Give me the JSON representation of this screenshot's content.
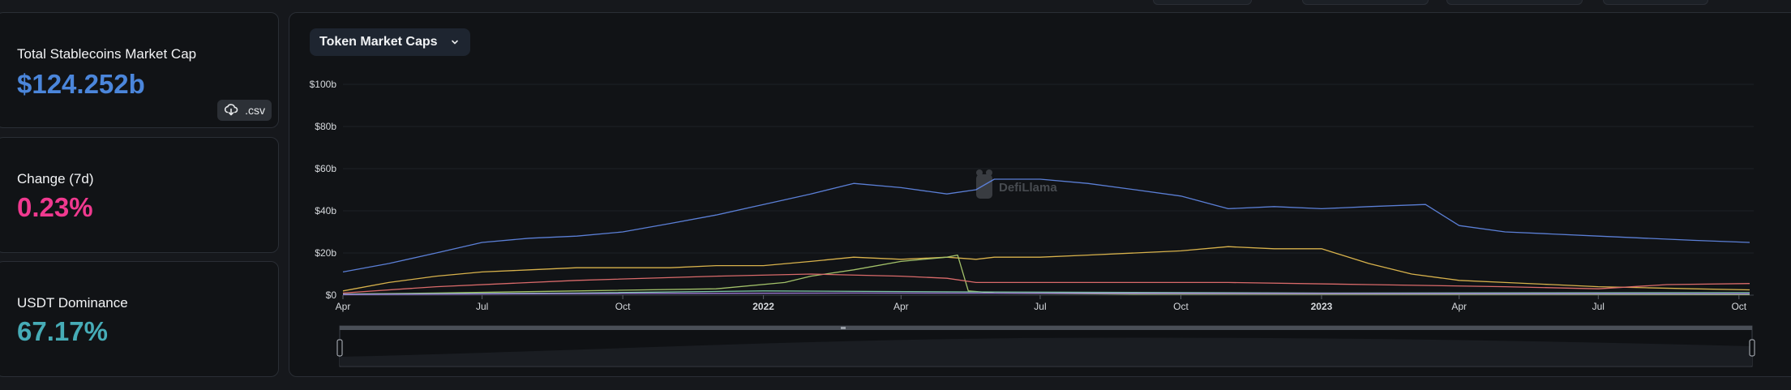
{
  "stats": {
    "market_cap": {
      "label": "Total Stablecoins Market Cap",
      "value": "$124.252b",
      "color": "#4b86db"
    },
    "change": {
      "label": "Change (7d)",
      "value": "0.23%",
      "color": "#f0398f"
    },
    "dominance": {
      "label": "USDT Dominance",
      "value": "67.17%",
      "color": "#46acb7"
    },
    "csv_button": {
      "label": ".csv",
      "icon": "cloud-download-icon"
    }
  },
  "chart_panel": {
    "selector_label": "Token Market Caps",
    "selector_icon": "chevron-down-icon",
    "watermark": "DefiLlama"
  },
  "chart_data": {
    "type": "line",
    "x_tick_labels": [
      "Apr",
      "Jul",
      "Oct",
      "2022",
      "Apr",
      "Jul",
      "Oct",
      "2023",
      "Apr",
      "Jul",
      "Oct"
    ],
    "x_tick_bold": [
      false,
      false,
      false,
      true,
      false,
      false,
      false,
      true,
      false,
      false,
      false
    ],
    "y_tick_labels": [
      "$0",
      "$20b",
      "$40b",
      "$60b",
      "$80b",
      "$100b"
    ],
    "y_ticks": [
      0,
      20,
      40,
      60,
      80,
      100
    ],
    "ylim": [
      0,
      100
    ],
    "x_start": "2021-04-01",
    "x_end": "2023-10-08",
    "grid": true,
    "series": [
      {
        "color": "#5b7fd6",
        "points": [
          [
            "2021-04-01",
            11
          ],
          [
            "2021-05-01",
            15
          ],
          [
            "2021-06-01",
            20
          ],
          [
            "2021-07-01",
            25
          ],
          [
            "2021-08-01",
            27
          ],
          [
            "2021-09-01",
            28
          ],
          [
            "2021-10-01",
            30
          ],
          [
            "2021-11-01",
            34
          ],
          [
            "2021-12-01",
            38
          ],
          [
            "2022-01-01",
            43
          ],
          [
            "2022-02-01",
            48
          ],
          [
            "2022-03-01",
            53
          ],
          [
            "2022-04-01",
            51
          ],
          [
            "2022-05-01",
            48
          ],
          [
            "2022-05-20",
            50
          ],
          [
            "2022-06-01",
            55
          ],
          [
            "2022-07-01",
            55
          ],
          [
            "2022-08-01",
            53
          ],
          [
            "2022-09-01",
            50
          ],
          [
            "2022-10-01",
            47
          ],
          [
            "2022-11-01",
            41
          ],
          [
            "2022-12-01",
            42
          ],
          [
            "2023-01-01",
            41
          ],
          [
            "2023-02-01",
            42
          ],
          [
            "2023-03-10",
            43
          ],
          [
            "2023-04-01",
            33
          ],
          [
            "2023-05-01",
            30
          ],
          [
            "2023-06-01",
            29
          ],
          [
            "2023-07-01",
            28
          ],
          [
            "2023-08-01",
            27
          ],
          [
            "2023-09-01",
            26
          ],
          [
            "2023-10-08",
            25
          ]
        ]
      },
      {
        "color": "#d8b24c",
        "points": [
          [
            "2021-04-01",
            2
          ],
          [
            "2021-05-01",
            6
          ],
          [
            "2021-06-01",
            9
          ],
          [
            "2021-07-01",
            11
          ],
          [
            "2021-08-01",
            12
          ],
          [
            "2021-09-01",
            13
          ],
          [
            "2021-10-01",
            13
          ],
          [
            "2021-11-01",
            13
          ],
          [
            "2021-12-01",
            14
          ],
          [
            "2022-01-01",
            14
          ],
          [
            "2022-02-01",
            16
          ],
          [
            "2022-03-01",
            18
          ],
          [
            "2022-04-01",
            17
          ],
          [
            "2022-05-01",
            18
          ],
          [
            "2022-05-20",
            17
          ],
          [
            "2022-06-01",
            18
          ],
          [
            "2022-07-01",
            18
          ],
          [
            "2022-08-01",
            19
          ],
          [
            "2022-09-01",
            20
          ],
          [
            "2022-10-01",
            21
          ],
          [
            "2022-11-01",
            23
          ],
          [
            "2022-12-01",
            22
          ],
          [
            "2023-01-01",
            22
          ],
          [
            "2023-02-01",
            15
          ],
          [
            "2023-03-01",
            10
          ],
          [
            "2023-04-01",
            7
          ],
          [
            "2023-05-01",
            6
          ],
          [
            "2023-06-01",
            5
          ],
          [
            "2023-07-01",
            4
          ],
          [
            "2023-08-01",
            3.5
          ],
          [
            "2023-09-01",
            3
          ],
          [
            "2023-10-08",
            2.5
          ]
        ]
      },
      {
        "color": "#a3c26a",
        "points": [
          [
            "2021-04-01",
            0.5
          ],
          [
            "2021-06-01",
            1
          ],
          [
            "2021-09-01",
            2
          ],
          [
            "2021-12-01",
            3
          ],
          [
            "2022-01-15",
            6
          ],
          [
            "2022-02-01",
            9
          ],
          [
            "2022-03-01",
            12
          ],
          [
            "2022-04-01",
            16
          ],
          [
            "2022-05-01",
            18
          ],
          [
            "2022-05-08",
            19
          ],
          [
            "2022-05-15",
            2
          ],
          [
            "2022-06-01",
            1
          ],
          [
            "2022-09-01",
            0.5
          ],
          [
            "2023-10-08",
            0.3
          ]
        ]
      },
      {
        "color": "#d96a6a",
        "points": [
          [
            "2021-04-01",
            1
          ],
          [
            "2021-06-01",
            4
          ],
          [
            "2021-09-01",
            7
          ],
          [
            "2021-12-01",
            9
          ],
          [
            "2022-02-01",
            10
          ],
          [
            "2022-04-01",
            9
          ],
          [
            "2022-05-01",
            8
          ],
          [
            "2022-05-20",
            6
          ],
          [
            "2022-08-01",
            6
          ],
          [
            "2022-11-01",
            6
          ],
          [
            "2023-02-01",
            5
          ],
          [
            "2023-05-01",
            4
          ],
          [
            "2023-07-01",
            3
          ],
          [
            "2023-08-15",
            5
          ],
          [
            "2023-10-08",
            5.5
          ]
        ]
      },
      {
        "color": "#7ec6a8",
        "points": [
          [
            "2021-04-01",
            0.5
          ],
          [
            "2021-09-01",
            1
          ],
          [
            "2022-01-01",
            2
          ],
          [
            "2022-06-01",
            1.5
          ],
          [
            "2023-01-01",
            1
          ],
          [
            "2023-10-08",
            1.2
          ]
        ]
      },
      {
        "color": "#9c7ad8",
        "points": [
          [
            "2021-04-01",
            0.3
          ],
          [
            "2021-10-01",
            0.8
          ],
          [
            "2022-03-01",
            1
          ],
          [
            "2022-09-01",
            0.9
          ],
          [
            "2023-10-08",
            0.6
          ]
        ]
      }
    ]
  }
}
